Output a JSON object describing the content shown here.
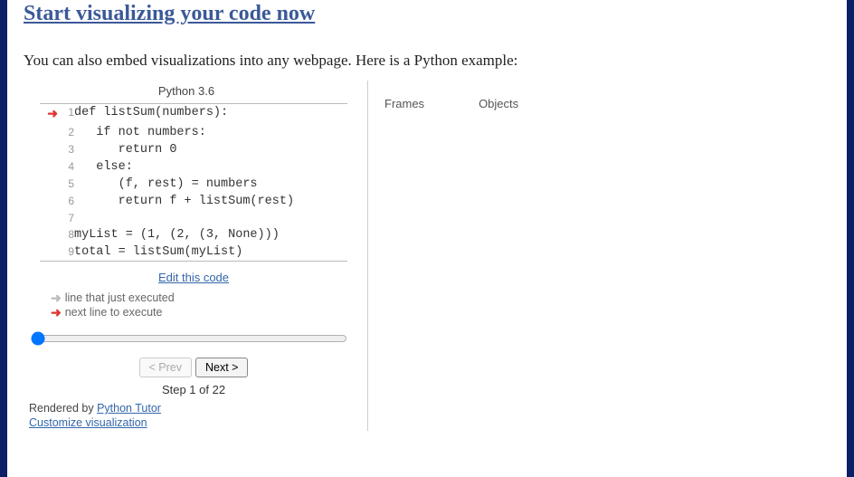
{
  "headline": "Start visualizing your code now",
  "intro": "You can also embed visualizations into any webpage. Here is a Python example:",
  "lang_label": "Python 3.6",
  "code": {
    "current_line": 1,
    "lines": [
      {
        "n": 1,
        "text": "def listSum(numbers):"
      },
      {
        "n": 2,
        "text": "   if not numbers:"
      },
      {
        "n": 3,
        "text": "      return 0"
      },
      {
        "n": 4,
        "text": "   else:"
      },
      {
        "n": 5,
        "text": "      (f, rest) = numbers"
      },
      {
        "n": 6,
        "text": "      return f + listSum(rest)"
      },
      {
        "n": 7,
        "text": ""
      },
      {
        "n": 8,
        "text": "myList = (1, (2, (3, None)))"
      },
      {
        "n": 9,
        "text": "total = listSum(myList)"
      }
    ]
  },
  "edit_link": "Edit this code",
  "legend": {
    "just_executed": "line that just executed",
    "next_to_execute": "next line to execute"
  },
  "controls": {
    "prev_label": "< Prev",
    "next_label": "Next >",
    "step_text": "Step 1 of 22",
    "slider_value": 1,
    "slider_max": 22
  },
  "footer": {
    "rendered_by_prefix": "Rendered by ",
    "rendered_by_link": "Python Tutor",
    "customize": "Customize visualization"
  },
  "frames_heading": "Frames",
  "objects_heading": "Objects"
}
